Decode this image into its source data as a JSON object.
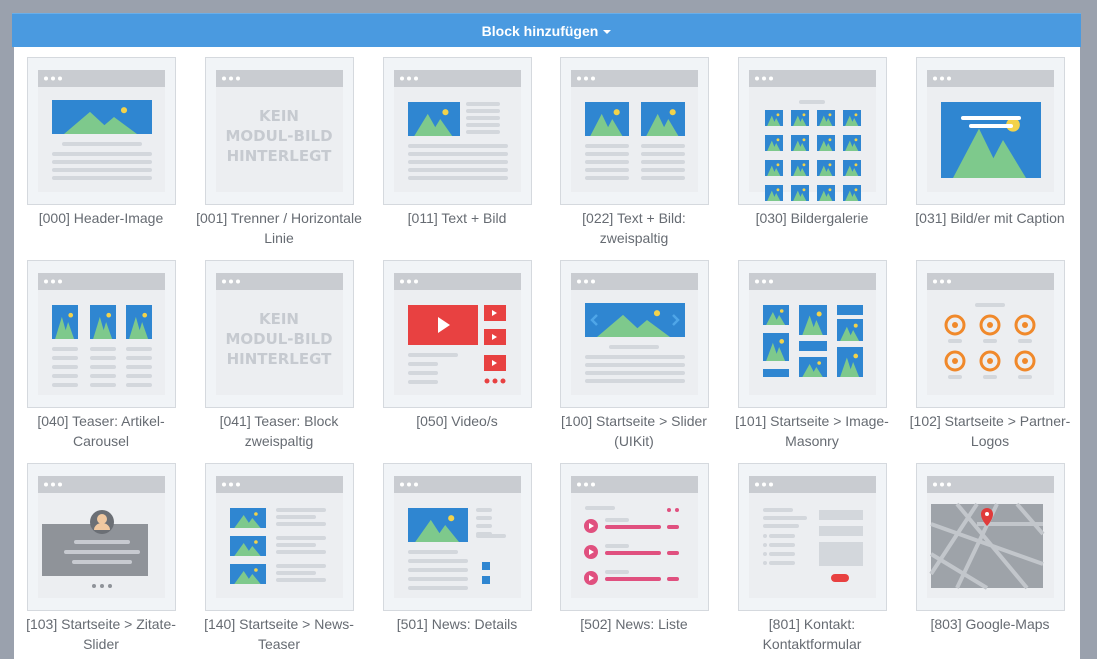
{
  "header": {
    "button_label": "Block hinzufügen"
  },
  "placeholder": {
    "line1": "KEIN",
    "line2": "MODUL-BILD",
    "line3": "HINTERLEGT"
  },
  "blocks": [
    {
      "label": "[000] Header-Image",
      "preview": "header-image"
    },
    {
      "label": "[001] Trenner / Horizontale Linie",
      "preview": "none"
    },
    {
      "label": "[011] Text + Bild",
      "preview": "text-image"
    },
    {
      "label": "[022] Text + Bild: zweispaltig",
      "preview": "text-image-two-col"
    },
    {
      "label": "[030] Bildergalerie",
      "preview": "gallery"
    },
    {
      "label": "[031] Bild/er mit Caption",
      "preview": "image-caption"
    },
    {
      "label": "[040] Teaser: Artikel-Carousel",
      "preview": "carousel"
    },
    {
      "label": "[041] Teaser: Block zweispaltig",
      "preview": "none"
    },
    {
      "label": "[050] Video/s",
      "preview": "video"
    },
    {
      "label": "[100] Startseite > Slider (UIKit)",
      "preview": "slider"
    },
    {
      "label": "[101] Startseite > Image-Masonry",
      "preview": "masonry"
    },
    {
      "label": "[102] Startseite > Partner-Logos",
      "preview": "logos"
    },
    {
      "label": "[103] Startseite > Zitate-Slider",
      "preview": "quotes"
    },
    {
      "label": "[140] Startseite > News-Teaser",
      "preview": "news-teaser"
    },
    {
      "label": "[501] News: Details",
      "preview": "news-details"
    },
    {
      "label": "[502] News: Liste",
      "preview": "news-list"
    },
    {
      "label": "[801] Kontakt: Kontaktformular",
      "preview": "contact-form"
    },
    {
      "label": "[803] Google-Maps",
      "preview": "map"
    }
  ],
  "colors": {
    "accent": "#4a9ae0",
    "image_blue": "#2f86d1",
    "mountain": "#7ec98c",
    "sun": "#f2d24b",
    "video_red": "#e84141",
    "logo_orange": "#f0892b",
    "list_pink": "#e0507f"
  }
}
